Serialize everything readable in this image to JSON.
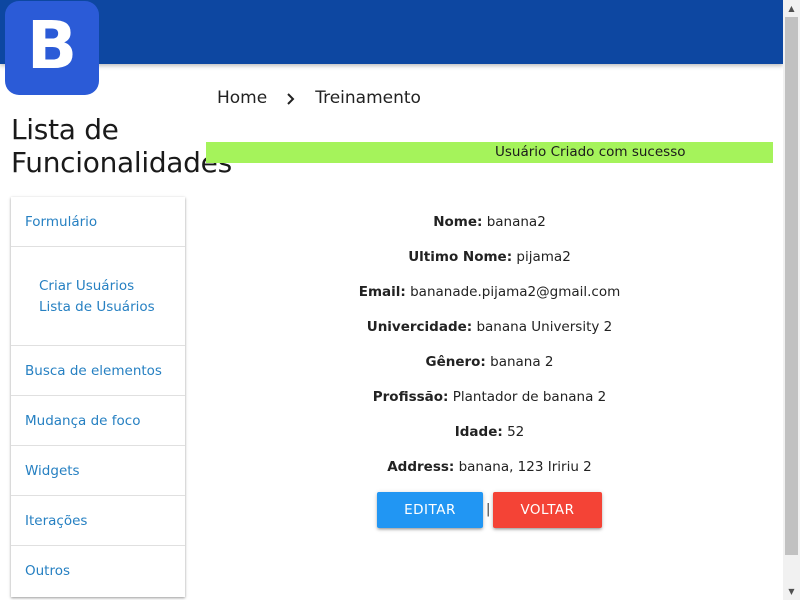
{
  "header": {
    "logo_letter": "B",
    "colors": {
      "topbar": "#0d47a1",
      "logo_bg": "#2b5bd7"
    }
  },
  "breadcrumb": {
    "home": "Home",
    "separator_icon": "chevron-right-icon",
    "current": "Treinamento"
  },
  "page_title": "Lista de Funcionalidades",
  "alert": {
    "message": "Usuário Criado com sucesso",
    "color": "#a5f35b"
  },
  "sidebar": {
    "items": [
      {
        "label": "Formulário"
      },
      {
        "label": "Busca de elementos"
      },
      {
        "label": "Mudança de foco"
      },
      {
        "label": "Widgets"
      },
      {
        "label": "Iterações"
      },
      {
        "label": "Outros"
      }
    ],
    "sub_items": [
      {
        "label": "Criar Usuários"
      },
      {
        "label": "Lista de Usuários"
      }
    ],
    "link_color": "#2680c2"
  },
  "user": {
    "fields": [
      {
        "label": "Nome:",
        "value": "banana2"
      },
      {
        "label": "Ultimo Nome:",
        "value": "pijama2"
      },
      {
        "label": "Email:",
        "value": "bananade.pijama2@gmail.com"
      },
      {
        "label": "Univercidade:",
        "value": "banana University 2"
      },
      {
        "label": "Gênero:",
        "value": "banana 2"
      },
      {
        "label": "Profissão:",
        "value": "Plantador de banana 2"
      },
      {
        "label": "Idade:",
        "value": "52"
      },
      {
        "label": "Address:",
        "value": "banana, 123 Iririu 2"
      }
    ]
  },
  "actions": {
    "edit_label": "EDITAR",
    "separator": "|",
    "back_label": "VOLTAR",
    "colors": {
      "edit": "#2196f3",
      "back": "#f44336"
    }
  }
}
